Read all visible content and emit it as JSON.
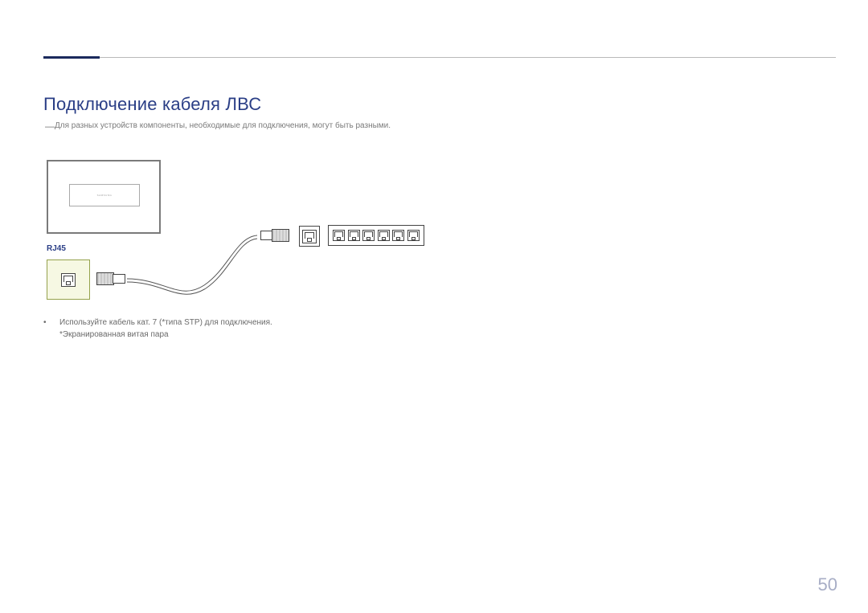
{
  "colors": {
    "accent": "#2a3e86",
    "body_text": "#5a5a5a",
    "highlight_bg": "#f6f8e3",
    "highlight_border": "#95a24c",
    "page_num": "#a8aec6",
    "header_bar": "#1b2a5c"
  },
  "heading": "Подключение кабеля ЛВС",
  "intro_note": "Для разных устройств компоненты, необходимые для подключения, могут быть разными.",
  "diagram": {
    "monitor_brand": "SAMSUNG",
    "rj45_label": "RJ45",
    "switch_port_count": 6
  },
  "bullet": {
    "line1": "Используйте кабель кат. 7 (*типа STP) для подключения.",
    "line2": "*Экранированная витая пара"
  },
  "page_number": "50"
}
